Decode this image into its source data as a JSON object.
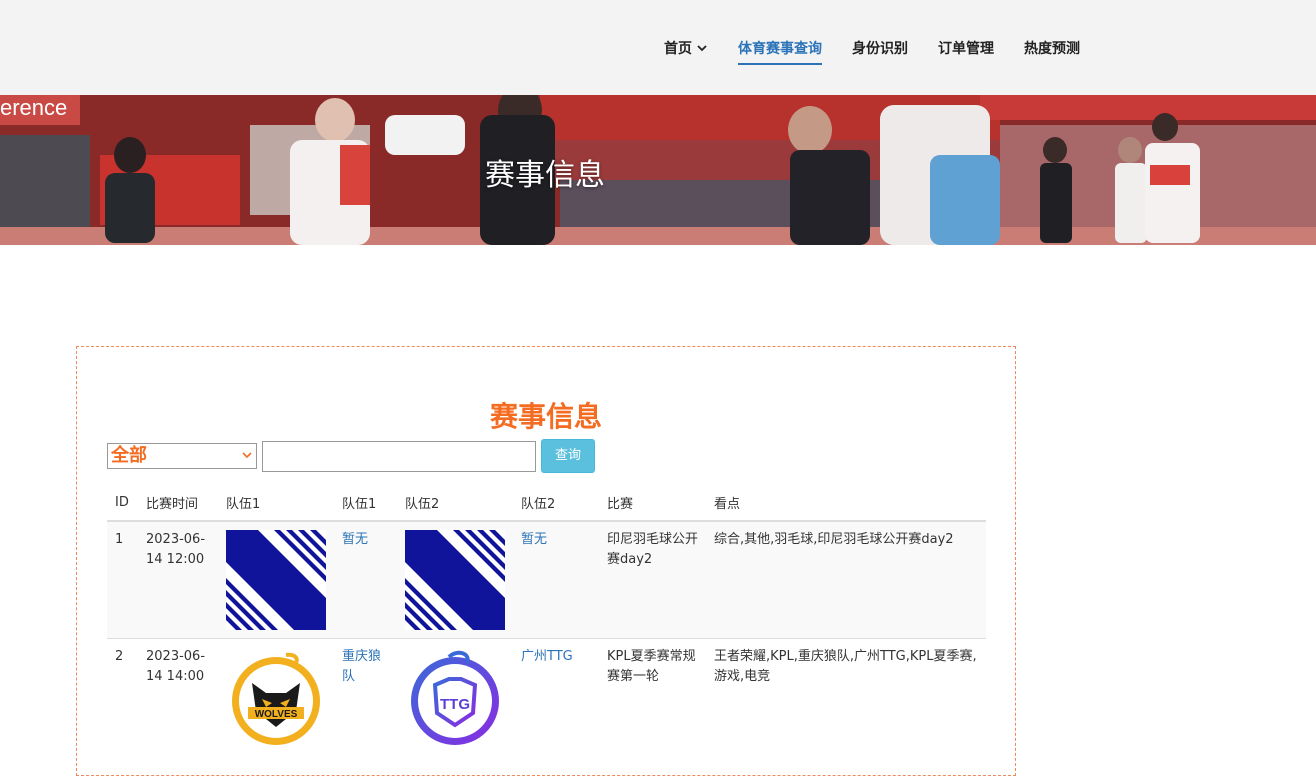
{
  "nav": {
    "items": [
      {
        "label": "首页"
      },
      {
        "label": "体育赛事查询"
      },
      {
        "label": "身份识别"
      },
      {
        "label": "订单管理"
      },
      {
        "label": "热度预测"
      }
    ]
  },
  "banner": {
    "title": "赛事信息",
    "sign_text": "erence"
  },
  "card": {
    "title": "赛事信息",
    "filter_value": "全部",
    "search_value": "",
    "search_button": "查询"
  },
  "table": {
    "headers": [
      "ID",
      "比赛时间",
      "队伍1",
      "队伍1",
      "队伍2",
      "队伍2",
      "比赛",
      "看点"
    ],
    "rows": [
      {
        "id": "1",
        "time": "2023-06-14 12:00",
        "team1_logo": "x-stripes-logo",
        "team1": "暂无",
        "team2_logo": "x-stripes-logo",
        "team2": "暂无",
        "match": "印尼羽毛球公开赛day2",
        "highlights": "综合,其他,羽毛球,印尼羽毛球公开赛day2"
      },
      {
        "id": "2",
        "time": "2023-06-14 14:00",
        "team1_logo": "wolves-logo",
        "team1": "重庆狼队",
        "team2_logo": "ttg-logo",
        "team2": "广州TTG",
        "match": "KPL夏季赛常规赛第一轮",
        "highlights": "王者荣耀,KPL,重庆狼队,广州TTG,KPL夏季赛,游戏,电竞"
      }
    ]
  },
  "colors": {
    "accent": "#f36c21",
    "link": "#2a73b8",
    "button": "#5bc0de"
  }
}
